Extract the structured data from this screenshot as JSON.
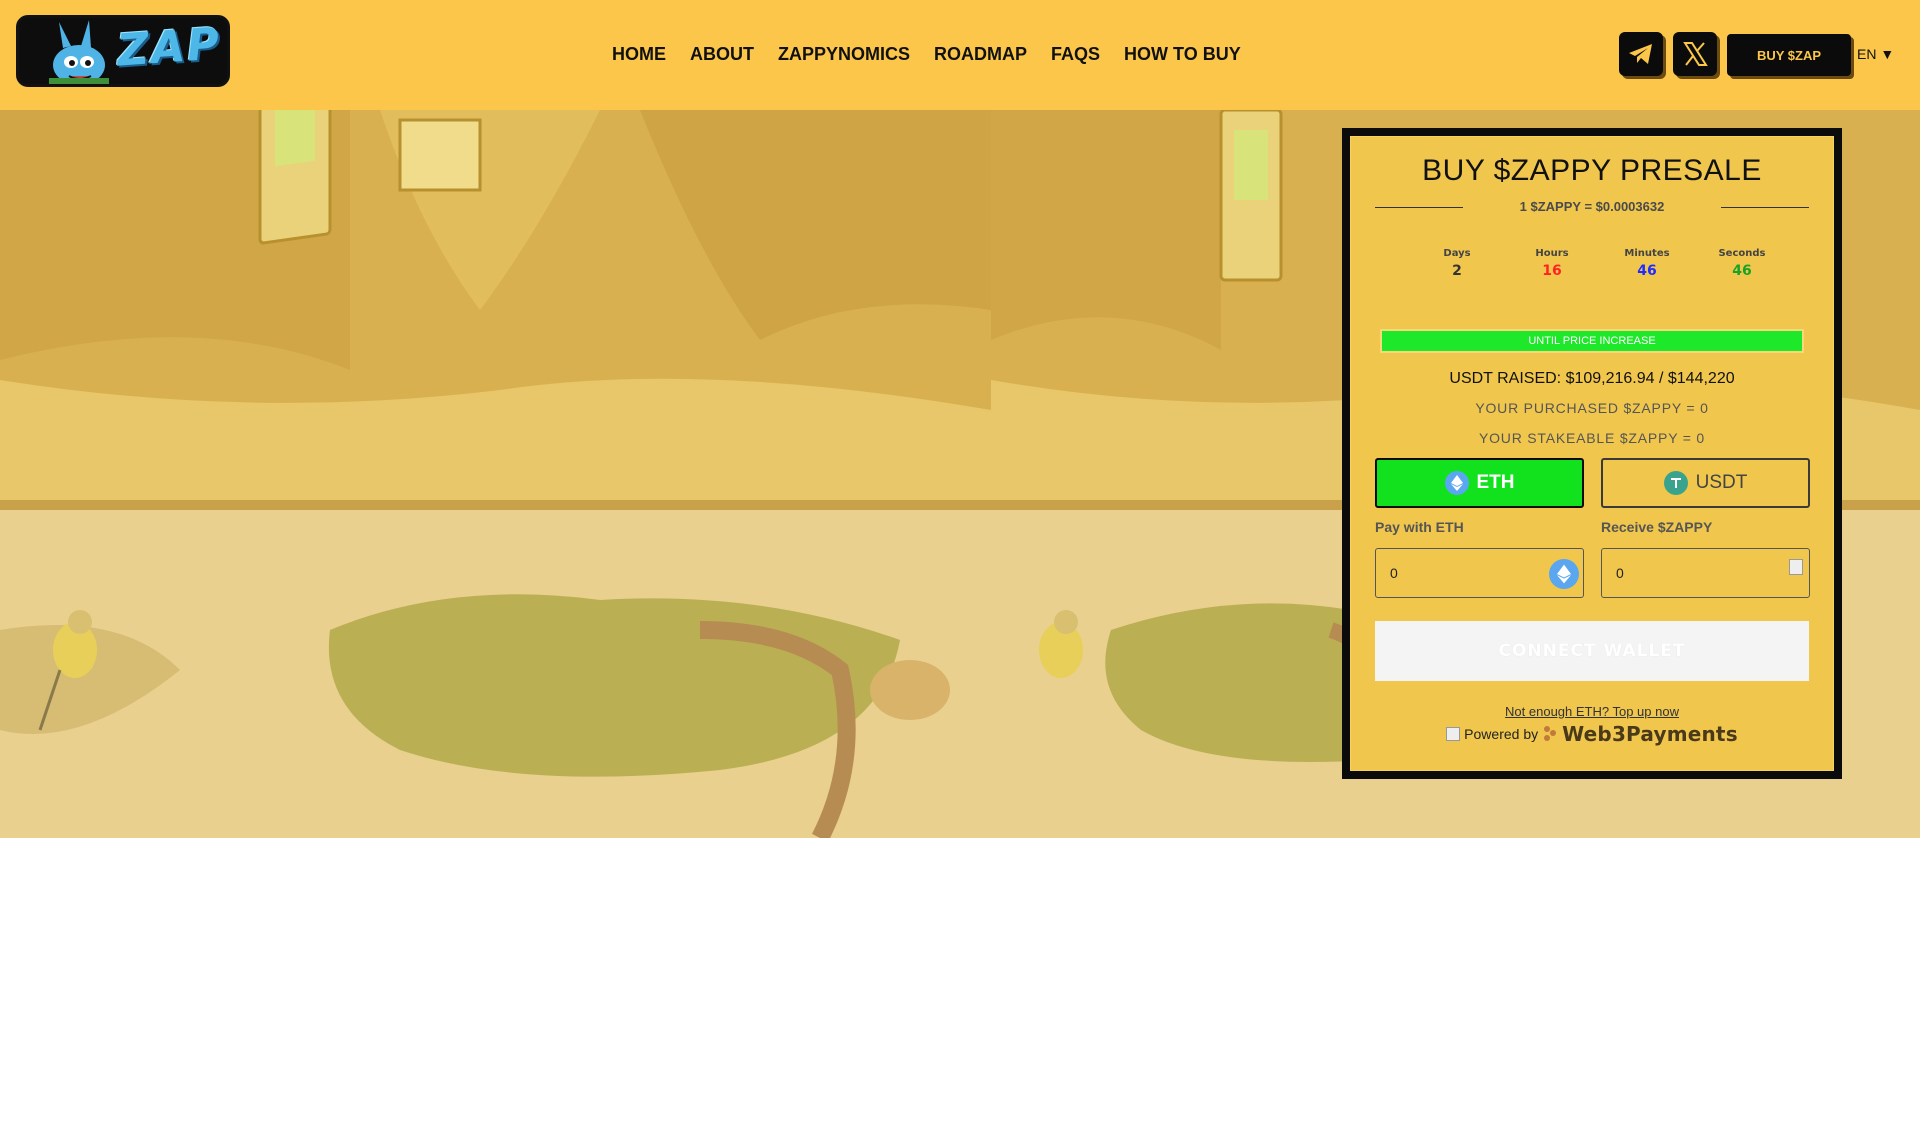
{
  "brand": {
    "logo_text": "ZAP"
  },
  "nav": {
    "items": [
      "HOME",
      "ABOUT",
      "ZAPPYNOMICS",
      "ROADMAP",
      "FAQS",
      "HOW TO BUY"
    ]
  },
  "header": {
    "telegram_icon": "telegram-icon",
    "x_icon": "x-twitter-icon",
    "buy_label": "BUY $ZAP",
    "language": "EN ▼"
  },
  "colors": {
    "header_bg": "#fbc64a",
    "card_bg": "#f0c64d",
    "eth_active": "#12e21d",
    "progress": "#1ee82a",
    "hours": "#ff2323",
    "minutes": "#1f2bff",
    "seconds": "#19a326"
  },
  "presale": {
    "title": "BUY $ZAPPY PRESALE",
    "rate": "1 $ZAPPY = $0.0003632",
    "timer": {
      "days_label": "Days",
      "days": "2",
      "hours_label": "Hours",
      "hours": "16",
      "minutes_label": "Minutes",
      "minutes": "46",
      "seconds_label": "Seconds",
      "seconds": "46"
    },
    "progress_label": "UNTIL PRICE INCREASE",
    "raised": "USDT RAISED: $109,216.94 / $144,220",
    "purchased": "YOUR PURCHASED $ZAPPY = 0",
    "stakeable": "YOUR STAKEABLE $ZAPPY = 0",
    "tokens": {
      "eth_label": "ETH",
      "usdt_label": "USDT",
      "selected": "ETH"
    },
    "pay_label": "Pay with ETH",
    "receive_label": "Receive $ZAPPY",
    "pay_value": "0",
    "receive_value": "0",
    "connect_label": "CONNECT WALLET",
    "topup_link": "Not enough ETH? Top up now",
    "powered_by": "Powered by",
    "provider": "Web3Payments"
  }
}
